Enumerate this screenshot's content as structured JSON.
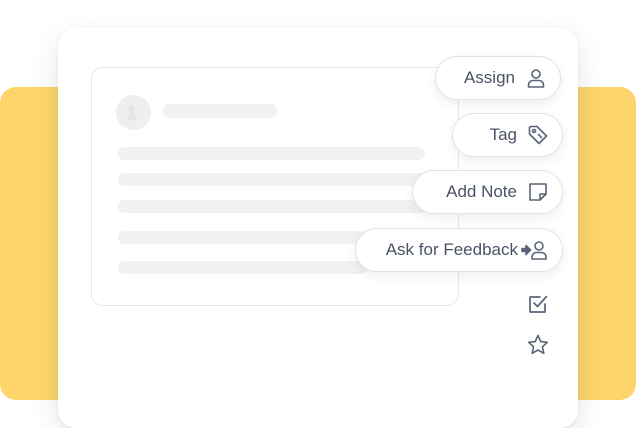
{
  "colors": {
    "accent_yellow": "#FDD56A",
    "icon_stroke": "#5A6478",
    "label_text": "#4A5266"
  },
  "actions": [
    {
      "label": "Assign",
      "icon": "user-icon"
    },
    {
      "label": "Tag",
      "icon": "tag-icon"
    },
    {
      "label": "Add Note",
      "icon": "sticky-note-icon"
    },
    {
      "label": "Ask for Feedback",
      "icon": "feedback-user-icon"
    }
  ],
  "side_icons": [
    {
      "icon": "checkbox-icon"
    },
    {
      "icon": "star-icon"
    }
  ]
}
